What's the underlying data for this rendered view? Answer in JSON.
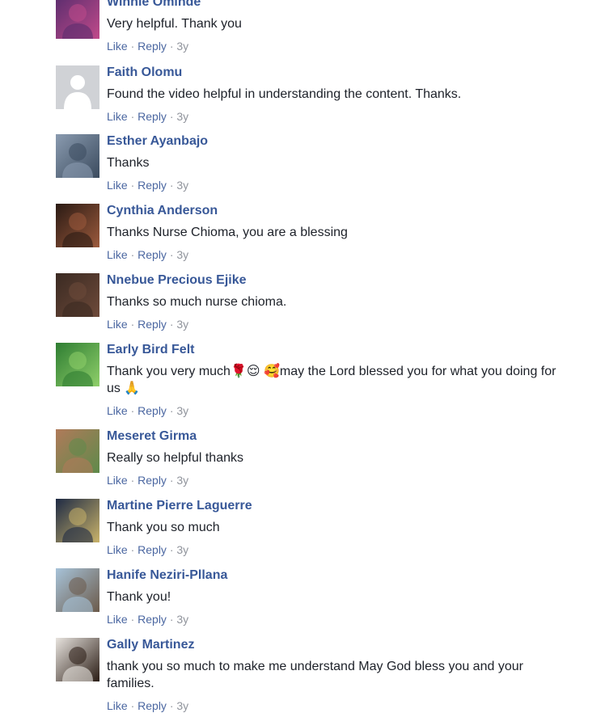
{
  "comments": [
    {
      "author": "Winnie Ominde",
      "text": "Very helpful. Thank you",
      "like": "Like",
      "reply": "Reply",
      "time": "3y",
      "avatar_icon": "photo-avatar",
      "avatar_colors": [
        "#5a2d6e",
        "#c04a8a"
      ]
    },
    {
      "author": "Faith Olomu",
      "text": "Found the video helpful in understanding the content. Thanks.",
      "like": "Like",
      "reply": "Reply",
      "time": "3y",
      "avatar_icon": "default-user-avatar",
      "avatar_colors": [
        "#d0d2d6",
        "#ffffff"
      ]
    },
    {
      "author": "Esther Ayanbajo",
      "text": "Thanks",
      "like": "Like",
      "reply": "Reply",
      "time": "3y",
      "avatar_icon": "photo-avatar",
      "avatar_colors": [
        "#8a9bb0",
        "#3b4b5e"
      ]
    },
    {
      "author": "Cynthia Anderson",
      "text": "Thanks Nurse Chioma, you are a blessing",
      "like": "Like",
      "reply": "Reply",
      "time": "3y",
      "avatar_icon": "photo-avatar",
      "avatar_colors": [
        "#2a1a14",
        "#9c5a3c"
      ]
    },
    {
      "author": "Nnebue Precious Ejike",
      "text": "Thanks so much nurse chioma.",
      "like": "Like",
      "reply": "Reply",
      "time": "3y",
      "avatar_icon": "photo-avatar",
      "avatar_colors": [
        "#3a2a22",
        "#6e4a3a"
      ]
    },
    {
      "author": "Early Bird Felt",
      "text": "Thank you very much🌹😌 🥰may the Lord blessed you for what you doing for us 🙏",
      "like": "Like",
      "reply": "Reply",
      "time": "3y",
      "avatar_icon": "photo-avatar",
      "avatar_colors": [
        "#2e7d32",
        "#8fcf6a"
      ]
    },
    {
      "author": "Meseret Girma",
      "text": "Really so helpful thanks",
      "like": "Like",
      "reply": "Reply",
      "time": "3y",
      "avatar_icon": "photo-avatar",
      "avatar_colors": [
        "#b07a5a",
        "#5e8a4a"
      ]
    },
    {
      "author": "Martine Pierre Laguerre",
      "text": "Thank you so much",
      "like": "Like",
      "reply": "Reply",
      "time": "3y",
      "avatar_icon": "photo-avatar",
      "avatar_colors": [
        "#1e2a44",
        "#c9b36a"
      ]
    },
    {
      "author": "Hanife Neziri-Pllana",
      "text": "Thank you!",
      "like": "Like",
      "reply": "Reply",
      "time": "3y",
      "avatar_icon": "photo-avatar",
      "avatar_colors": [
        "#a7c3d9",
        "#6b5a4a"
      ]
    },
    {
      "author": "Gally Martinez",
      "text": "thank you so much to make me understand May God bless you and your families.",
      "like": "Like",
      "reply": "Reply",
      "time": "3y",
      "avatar_icon": "photo-avatar",
      "avatar_colors": [
        "#e8e4df",
        "#2a1c14"
      ]
    }
  ]
}
